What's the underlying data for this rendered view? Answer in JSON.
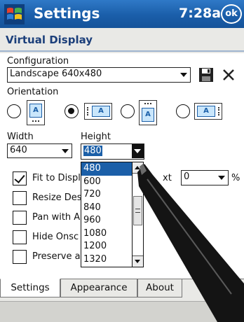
{
  "titlebar": {
    "title": "Settings",
    "time": "7:28a",
    "ok": "ok"
  },
  "page": {
    "title": "Virtual Display"
  },
  "configuration": {
    "label": "Configuration",
    "value": "Landscape 640x480"
  },
  "orientation": {
    "label": "Orientation",
    "selected_index": 1,
    "option_glyph": "A"
  },
  "width": {
    "label": "Width",
    "value": "640"
  },
  "height": {
    "label": "Height",
    "value": "480",
    "options": [
      "480",
      "600",
      "720",
      "840",
      "960",
      "1080",
      "1200",
      "1320"
    ],
    "selected_index": 0
  },
  "options": [
    {
      "label": "Fit to Displ",
      "checked": true
    },
    {
      "label": "Resize Des",
      "checked": false
    },
    {
      "label": "Pan with A",
      "checked": false
    },
    {
      "label": "Hide Onsc",
      "checked": false
    },
    {
      "label": "Preserve a",
      "checked": false
    }
  ],
  "text_margin": {
    "label_fragment": "xt",
    "value": "0",
    "unit": "%"
  },
  "tabs": [
    {
      "label": "Settings",
      "active": true
    },
    {
      "label": "Appearance",
      "active": false
    },
    {
      "label": "About",
      "active": false
    }
  ],
  "colors": {
    "titlebar": "#1a5ea9",
    "selection": "#1b5fa8",
    "page_title": "#1c3f7a"
  },
  "icons": {
    "start": "windows-flag-icon",
    "save": "floppy-disk-icon",
    "delete": "close-icon",
    "sip": "keyboard-icon"
  }
}
